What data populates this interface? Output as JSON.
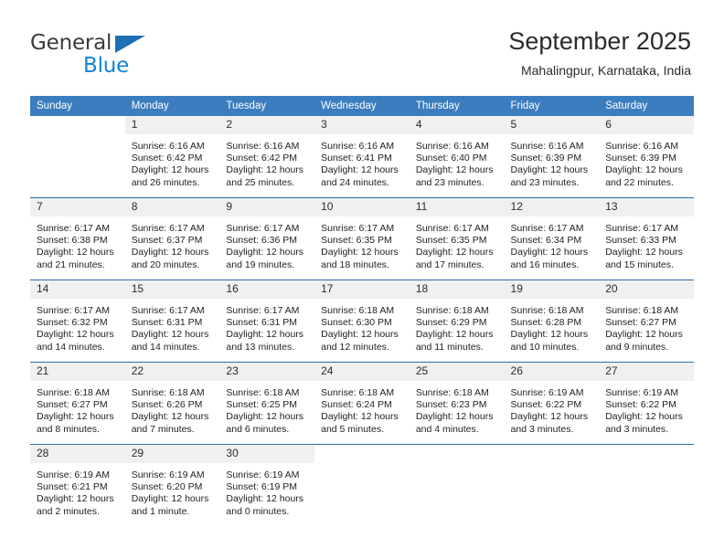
{
  "brand": {
    "line1": "General",
    "line2": "Blue",
    "triangle_color": "#1f6fb5",
    "line1_color": "#3b3b3b",
    "line2_color": "#1184d8"
  },
  "header": {
    "title": "September 2025",
    "subtitle": "Mahalingpur, Karnataka, India"
  },
  "theme": {
    "header_bg": "#3b7dbf",
    "header_text": "#ffffff",
    "week_divider": "#2f6da8",
    "daynum_bg": "#f0f0f0",
    "cell_bg": "#ffffff",
    "body_text": "#222222"
  },
  "weekdays": [
    "Sunday",
    "Monday",
    "Tuesday",
    "Wednesday",
    "Thursday",
    "Friday",
    "Saturday"
  ],
  "weeks": [
    [
      {
        "day": "",
        "sunrise": "",
        "sunset": "",
        "daylight1": "",
        "daylight2": ""
      },
      {
        "day": "1",
        "sunrise": "Sunrise: 6:16 AM",
        "sunset": "Sunset: 6:42 PM",
        "daylight1": "Daylight: 12 hours",
        "daylight2": "and 26 minutes."
      },
      {
        "day": "2",
        "sunrise": "Sunrise: 6:16 AM",
        "sunset": "Sunset: 6:42 PM",
        "daylight1": "Daylight: 12 hours",
        "daylight2": "and 25 minutes."
      },
      {
        "day": "3",
        "sunrise": "Sunrise: 6:16 AM",
        "sunset": "Sunset: 6:41 PM",
        "daylight1": "Daylight: 12 hours",
        "daylight2": "and 24 minutes."
      },
      {
        "day": "4",
        "sunrise": "Sunrise: 6:16 AM",
        "sunset": "Sunset: 6:40 PM",
        "daylight1": "Daylight: 12 hours",
        "daylight2": "and 23 minutes."
      },
      {
        "day": "5",
        "sunrise": "Sunrise: 6:16 AM",
        "sunset": "Sunset: 6:39 PM",
        "daylight1": "Daylight: 12 hours",
        "daylight2": "and 23 minutes."
      },
      {
        "day": "6",
        "sunrise": "Sunrise: 6:16 AM",
        "sunset": "Sunset: 6:39 PM",
        "daylight1": "Daylight: 12 hours",
        "daylight2": "and 22 minutes."
      }
    ],
    [
      {
        "day": "7",
        "sunrise": "Sunrise: 6:17 AM",
        "sunset": "Sunset: 6:38 PM",
        "daylight1": "Daylight: 12 hours",
        "daylight2": "and 21 minutes."
      },
      {
        "day": "8",
        "sunrise": "Sunrise: 6:17 AM",
        "sunset": "Sunset: 6:37 PM",
        "daylight1": "Daylight: 12 hours",
        "daylight2": "and 20 minutes."
      },
      {
        "day": "9",
        "sunrise": "Sunrise: 6:17 AM",
        "sunset": "Sunset: 6:36 PM",
        "daylight1": "Daylight: 12 hours",
        "daylight2": "and 19 minutes."
      },
      {
        "day": "10",
        "sunrise": "Sunrise: 6:17 AM",
        "sunset": "Sunset: 6:35 PM",
        "daylight1": "Daylight: 12 hours",
        "daylight2": "and 18 minutes."
      },
      {
        "day": "11",
        "sunrise": "Sunrise: 6:17 AM",
        "sunset": "Sunset: 6:35 PM",
        "daylight1": "Daylight: 12 hours",
        "daylight2": "and 17 minutes."
      },
      {
        "day": "12",
        "sunrise": "Sunrise: 6:17 AM",
        "sunset": "Sunset: 6:34 PM",
        "daylight1": "Daylight: 12 hours",
        "daylight2": "and 16 minutes."
      },
      {
        "day": "13",
        "sunrise": "Sunrise: 6:17 AM",
        "sunset": "Sunset: 6:33 PM",
        "daylight1": "Daylight: 12 hours",
        "daylight2": "and 15 minutes."
      }
    ],
    [
      {
        "day": "14",
        "sunrise": "Sunrise: 6:17 AM",
        "sunset": "Sunset: 6:32 PM",
        "daylight1": "Daylight: 12 hours",
        "daylight2": "and 14 minutes."
      },
      {
        "day": "15",
        "sunrise": "Sunrise: 6:17 AM",
        "sunset": "Sunset: 6:31 PM",
        "daylight1": "Daylight: 12 hours",
        "daylight2": "and 14 minutes."
      },
      {
        "day": "16",
        "sunrise": "Sunrise: 6:17 AM",
        "sunset": "Sunset: 6:31 PM",
        "daylight1": "Daylight: 12 hours",
        "daylight2": "and 13 minutes."
      },
      {
        "day": "17",
        "sunrise": "Sunrise: 6:18 AM",
        "sunset": "Sunset: 6:30 PM",
        "daylight1": "Daylight: 12 hours",
        "daylight2": "and 12 minutes."
      },
      {
        "day": "18",
        "sunrise": "Sunrise: 6:18 AM",
        "sunset": "Sunset: 6:29 PM",
        "daylight1": "Daylight: 12 hours",
        "daylight2": "and 11 minutes."
      },
      {
        "day": "19",
        "sunrise": "Sunrise: 6:18 AM",
        "sunset": "Sunset: 6:28 PM",
        "daylight1": "Daylight: 12 hours",
        "daylight2": "and 10 minutes."
      },
      {
        "day": "20",
        "sunrise": "Sunrise: 6:18 AM",
        "sunset": "Sunset: 6:27 PM",
        "daylight1": "Daylight: 12 hours",
        "daylight2": "and 9 minutes."
      }
    ],
    [
      {
        "day": "21",
        "sunrise": "Sunrise: 6:18 AM",
        "sunset": "Sunset: 6:27 PM",
        "daylight1": "Daylight: 12 hours",
        "daylight2": "and 8 minutes."
      },
      {
        "day": "22",
        "sunrise": "Sunrise: 6:18 AM",
        "sunset": "Sunset: 6:26 PM",
        "daylight1": "Daylight: 12 hours",
        "daylight2": "and 7 minutes."
      },
      {
        "day": "23",
        "sunrise": "Sunrise: 6:18 AM",
        "sunset": "Sunset: 6:25 PM",
        "daylight1": "Daylight: 12 hours",
        "daylight2": "and 6 minutes."
      },
      {
        "day": "24",
        "sunrise": "Sunrise: 6:18 AM",
        "sunset": "Sunset: 6:24 PM",
        "daylight1": "Daylight: 12 hours",
        "daylight2": "and 5 minutes."
      },
      {
        "day": "25",
        "sunrise": "Sunrise: 6:18 AM",
        "sunset": "Sunset: 6:23 PM",
        "daylight1": "Daylight: 12 hours",
        "daylight2": "and 4 minutes."
      },
      {
        "day": "26",
        "sunrise": "Sunrise: 6:19 AM",
        "sunset": "Sunset: 6:22 PM",
        "daylight1": "Daylight: 12 hours",
        "daylight2": "and 3 minutes."
      },
      {
        "day": "27",
        "sunrise": "Sunrise: 6:19 AM",
        "sunset": "Sunset: 6:22 PM",
        "daylight1": "Daylight: 12 hours",
        "daylight2": "and 3 minutes."
      }
    ],
    [
      {
        "day": "28",
        "sunrise": "Sunrise: 6:19 AM",
        "sunset": "Sunset: 6:21 PM",
        "daylight1": "Daylight: 12 hours",
        "daylight2": "and 2 minutes."
      },
      {
        "day": "29",
        "sunrise": "Sunrise: 6:19 AM",
        "sunset": "Sunset: 6:20 PM",
        "daylight1": "Daylight: 12 hours",
        "daylight2": "and 1 minute."
      },
      {
        "day": "30",
        "sunrise": "Sunrise: 6:19 AM",
        "sunset": "Sunset: 6:19 PM",
        "daylight1": "Daylight: 12 hours",
        "daylight2": "and 0 minutes."
      },
      {
        "day": "",
        "sunrise": "",
        "sunset": "",
        "daylight1": "",
        "daylight2": ""
      },
      {
        "day": "",
        "sunrise": "",
        "sunset": "",
        "daylight1": "",
        "daylight2": ""
      },
      {
        "day": "",
        "sunrise": "",
        "sunset": "",
        "daylight1": "",
        "daylight2": ""
      },
      {
        "day": "",
        "sunrise": "",
        "sunset": "",
        "daylight1": "",
        "daylight2": ""
      }
    ]
  ]
}
